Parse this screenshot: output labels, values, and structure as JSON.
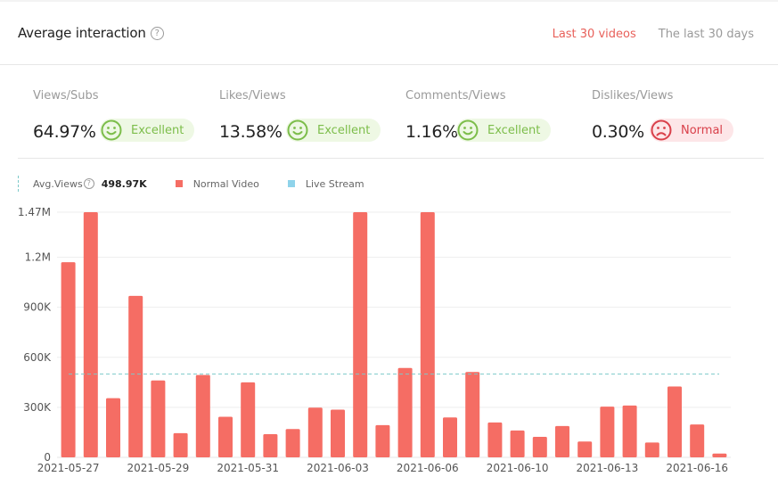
{
  "header": {
    "title": "Average interaction",
    "help_icon": "question-circle-icon",
    "tabs": [
      {
        "label": "Last 30 videos",
        "active": true
      },
      {
        "label": "The last 30 days",
        "active": false
      }
    ]
  },
  "metrics": [
    {
      "label": "Views/Subs",
      "value": "64.97%",
      "rating": "Excellent",
      "icon": "smile-face-icon",
      "tone": "good"
    },
    {
      "label": "Likes/Views",
      "value": "13.58%",
      "rating": "Excellent",
      "icon": "smile-face-icon",
      "tone": "good"
    },
    {
      "label": "Comments/Views",
      "value": "1.16%",
      "rating": "Excellent",
      "icon": "smile-face-icon",
      "tone": "good"
    },
    {
      "label": "Dislikes/Views",
      "value": "0.30%",
      "rating": "Normal",
      "icon": "sad-face-icon",
      "tone": "bad"
    }
  ],
  "colors": {
    "accent": "#e8605a",
    "bar": "#f56d64",
    "live": "#8fd3ea",
    "avg_line": "#7cc9c9",
    "good": "#7cbd4a",
    "good_bg": "#eef8e4",
    "bad": "#d9404a",
    "bad_bg": "#fde6e8"
  },
  "legend": {
    "avg_label": "Avg.Views",
    "avg_value": "498.97K",
    "normal_label": "Normal Video",
    "live_label": "Live Stream"
  },
  "chart_data": {
    "type": "bar",
    "title": "",
    "xlabel": "",
    "ylabel": "",
    "ylim": [
      0,
      1470000
    ],
    "yticks": [
      0,
      300000,
      600000,
      900000,
      1200000,
      1470000
    ],
    "ytick_labels": [
      "0",
      "300K",
      "600K",
      "900K",
      "1.2M",
      "1.47M"
    ],
    "grid": true,
    "legend_position": "top-left",
    "xtick_labels": [
      {
        "index": 0,
        "label": "2021-05-27"
      },
      {
        "index": 4,
        "label": "2021-05-29"
      },
      {
        "index": 8,
        "label": "2021-05-31"
      },
      {
        "index": 12,
        "label": "2021-06-03"
      },
      {
        "index": 16,
        "label": "2021-06-06"
      },
      {
        "index": 20,
        "label": "2021-06-10"
      },
      {
        "index": 24,
        "label": "2021-06-13"
      },
      {
        "index": 28,
        "label": "2021-06-16"
      }
    ],
    "avg_line": 498970,
    "series": [
      {
        "name": "Normal Video",
        "values": [
          1170000,
          1470000,
          355000,
          968000,
          461000,
          145000,
          494000,
          243000,
          450000,
          139000,
          170000,
          298000,
          286000,
          1470000,
          193000,
          536000,
          1470000,
          239000,
          512000,
          209000,
          161000,
          123000,
          188000,
          95000,
          304000,
          311000,
          89000,
          425000,
          197000,
          23000
        ]
      },
      {
        "name": "Live Stream",
        "values": []
      }
    ]
  }
}
